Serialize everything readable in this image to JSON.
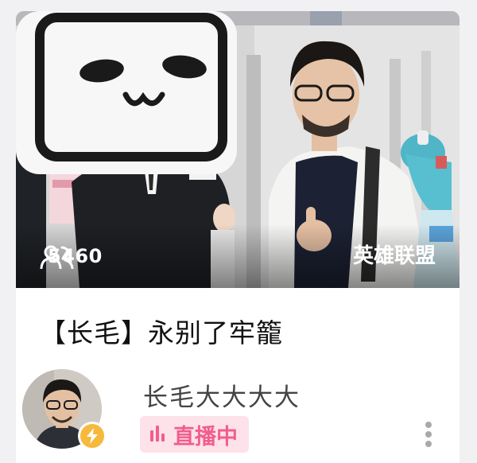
{
  "stream_card": {
    "viewer_count": "5460",
    "category": "英雄联盟",
    "title": "【长毛】永别了牢籠",
    "streamer_name": "长毛大大大大",
    "live_badge_label": "直播中",
    "viewer_icon": "people-icon",
    "live_icon": "bars-icon",
    "avatar_badge_icon": "lightning-icon",
    "menu_icon": "more-vertical-icon"
  },
  "colors": {
    "accent_pink": "#f25d8e",
    "live_badge_bg": "#fde2ea",
    "avatar_badge": "#f6b93b"
  }
}
